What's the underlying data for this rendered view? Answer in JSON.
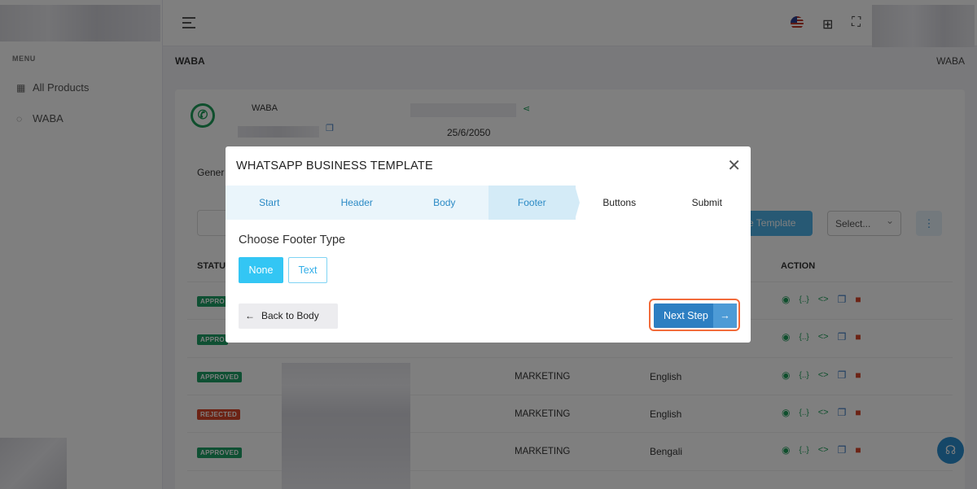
{
  "sidebar": {
    "menu_title": "MENU",
    "items": [
      {
        "label": "All Products",
        "icon": "grid-icon"
      },
      {
        "label": "WABA",
        "icon": "whatsapp-icon"
      }
    ]
  },
  "topbar": {
    "icons": [
      "menu-icon",
      "us-flag-icon",
      "apps-grid-icon",
      "fullscreen-icon"
    ]
  },
  "page": {
    "title": "WABA",
    "breadcrumb": "WABA"
  },
  "account": {
    "name": "WABA",
    "date": "25/6/2050"
  },
  "tab_general": "Gener",
  "toolbar": {
    "create_label": "e Template",
    "select_label": "Select..."
  },
  "table": {
    "headers": {
      "status": "STATU",
      "action": "ACTION"
    },
    "rows": [
      {
        "status": "APPRO",
        "category": "",
        "language": ""
      },
      {
        "status": "APPRO",
        "category": "",
        "language": ""
      },
      {
        "status": "APPROVED",
        "category": "MARKETING",
        "language": "English"
      },
      {
        "status": "REJECTED",
        "category": "MARKETING",
        "language": "English"
      },
      {
        "status": "APPROVED",
        "category": "MARKETING",
        "language": "Bengali"
      }
    ]
  },
  "modal": {
    "title": "WHATSAPP BUSINESS TEMPLATE",
    "tabs": [
      "Start",
      "Header",
      "Body",
      "Footer",
      "Buttons",
      "Submit"
    ],
    "active_tab": "Footer",
    "heading": "Choose Footer Type",
    "options": {
      "none": "None",
      "text": "Text"
    },
    "back_label": "Back to Body",
    "next_label": "Next Step"
  },
  "colors": {
    "accent": "#2d7fc2",
    "approved": "#1fa066",
    "rejected": "#d9472b",
    "highlight": "#f26b3a"
  }
}
